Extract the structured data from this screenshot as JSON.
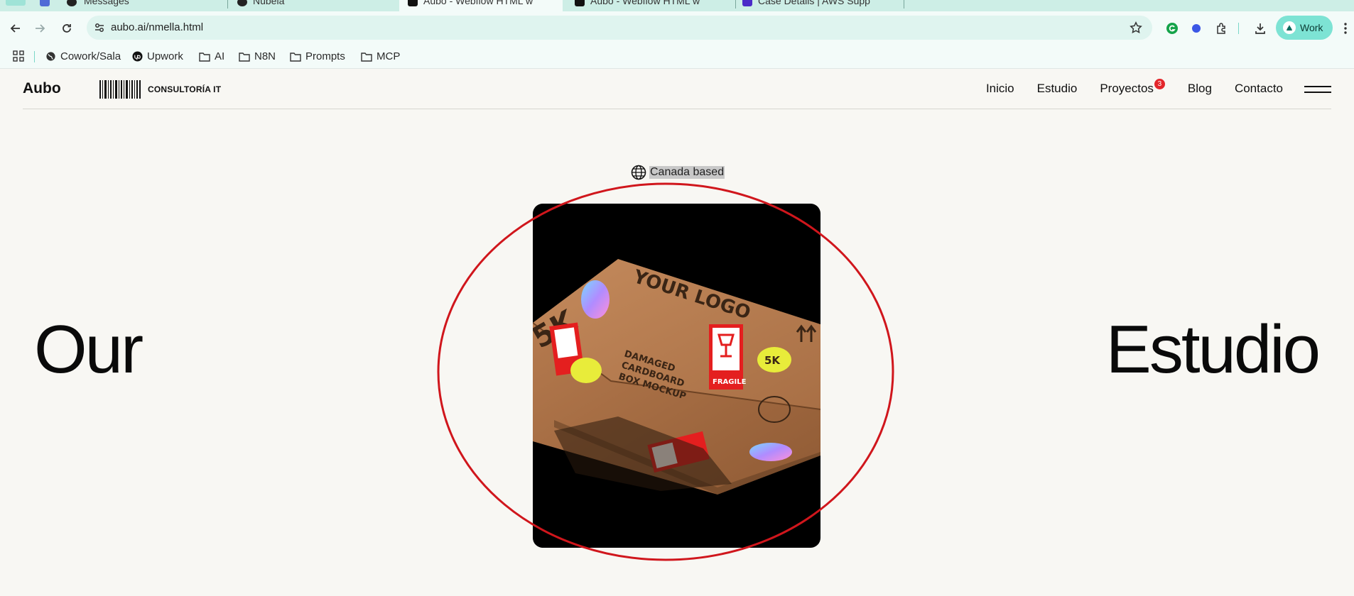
{
  "browser": {
    "tabs": [
      {
        "title": "Messages",
        "active": false
      },
      {
        "title": "Nubela",
        "active": false
      },
      {
        "title": "Aubo - Webflow HTML w",
        "active": true
      },
      {
        "title": "Aubo - Webflow HTML w",
        "active": false
      },
      {
        "title": "Case Details | AWS Supp",
        "active": false
      }
    ],
    "url": "aubo.ai/nmella.html",
    "profile_label": "Work",
    "bookmarks": [
      "Cowork/Sala",
      "Upwork",
      "AI",
      "N8N",
      "Prompts",
      "MCP"
    ]
  },
  "site": {
    "brand": "Aubo",
    "tagline": "CONSULTORÍA IT",
    "nav": [
      {
        "label": "Inicio"
      },
      {
        "label": "Estudio"
      },
      {
        "label": "Proyectos",
        "badge": "3"
      },
      {
        "label": "Blog"
      },
      {
        "label": "Contacto"
      }
    ],
    "location": "Canada based",
    "hero_left": "Our",
    "hero_right": "Estudio",
    "box": {
      "logo_text": "YOUR LOGO",
      "side_text": [
        "DAMAGED",
        "CARDBOARD",
        "BOX MOCKUP"
      ],
      "fragile": "FRAGILE",
      "sticker": "5K",
      "big_text": "5K"
    }
  },
  "colors": {
    "accent_teal": "#7de3d4",
    "badge_red": "#e3262b",
    "annotation_red": "#d0161c",
    "page_bg": "#f8f7f3"
  }
}
